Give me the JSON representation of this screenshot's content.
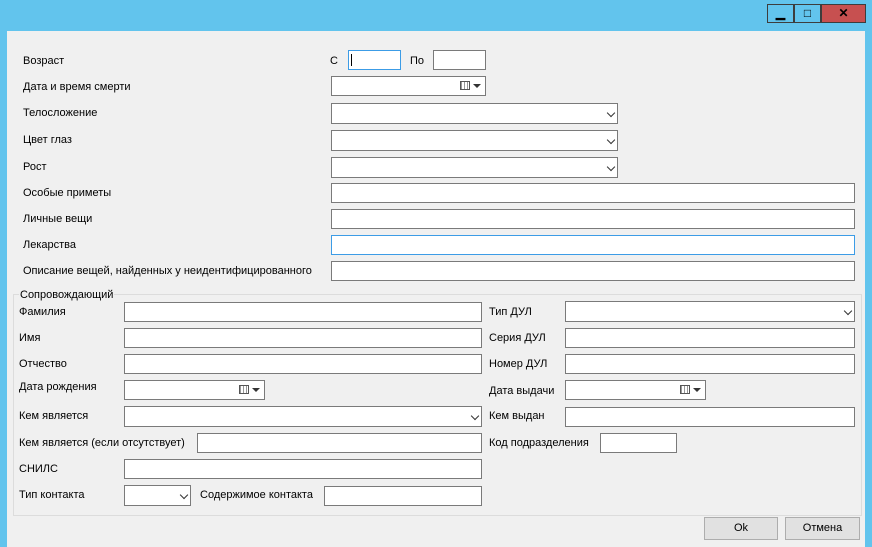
{
  "window": {
    "min_glyph": "▁",
    "max_glyph": "□",
    "close_glyph": "✕"
  },
  "form": {
    "age_label": "Возраст",
    "age_from_label": "С",
    "age_from_value": "",
    "age_to_label": "По",
    "age_to_value": "",
    "death_datetime_label": "Дата и время смерти",
    "death_datetime_value": "",
    "build_label": "Телосложение",
    "build_value": "",
    "eye_color_label": "Цвет глаз",
    "eye_color_value": "",
    "height_label": "Рост",
    "height_value": "",
    "special_marks_label": "Особые приметы",
    "special_marks_value": "",
    "personal_items_label": "Личные вещи",
    "personal_items_value": "",
    "medicines_label": "Лекарства",
    "medicines_value": "",
    "found_items_label": "Описание вещей, найденных у неидентифицированного",
    "found_items_value": ""
  },
  "escort": {
    "group_label": "Сопровождающий",
    "last_name_label": "Фамилия",
    "first_name_label": "Имя",
    "patronymic_label": "Отчество",
    "birth_date_label": "Дата рождения",
    "relation_label": "Кем является",
    "relation_other_label": "Кем является (если отсутствует)",
    "snils_label": "СНИЛС",
    "contact_type_label": "Тип контакта",
    "contact_content_label": "Содержимое контакта",
    "doc_type_label": "Тип ДУЛ",
    "doc_series_label": "Серия ДУЛ",
    "doc_number_label": "Номер ДУЛ",
    "issue_date_label": "Дата выдачи",
    "issued_by_label": "Кем выдан",
    "division_code_label": "Код подразделения"
  },
  "buttons": {
    "ok": "Ok",
    "cancel": "Отмена"
  },
  "colors": {
    "title_bar": "#62c4ed",
    "close_button": "#c75050",
    "focus_border": "#3c9ce6"
  }
}
